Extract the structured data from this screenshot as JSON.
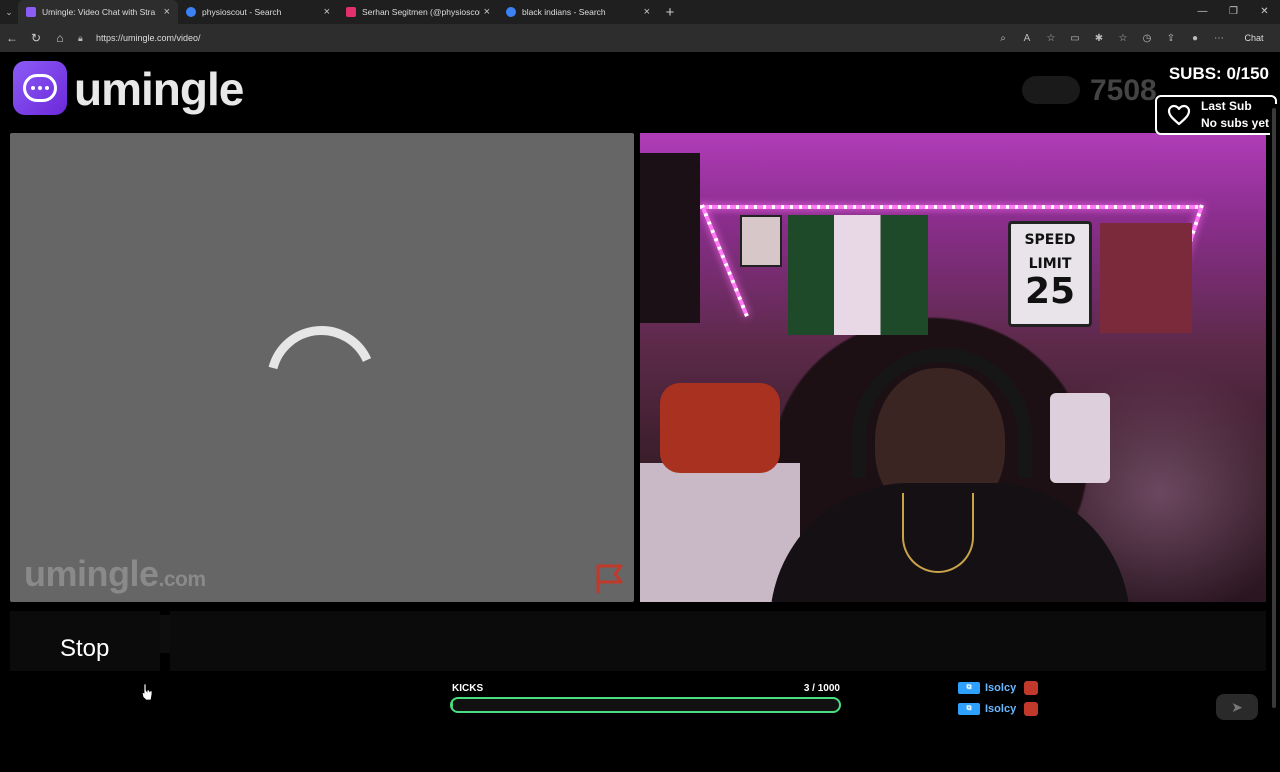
{
  "browser": {
    "tabs": [
      {
        "title": "Umingle: Video Chat with Stra",
        "favicon_color": "#8b5cf6",
        "active": true
      },
      {
        "title": "physioscout - Search",
        "favicon_color": "#3b82f6",
        "active": false
      },
      {
        "title": "Serhan Segitmen (@physioscout)",
        "favicon_color": "#e1306c",
        "active": false
      },
      {
        "title": "black indians - Search",
        "favicon_color": "#3b82f6",
        "active": false
      }
    ],
    "url": "https://umingle.com/video/",
    "chat_button_label": "Chat"
  },
  "site": {
    "logo_text": "umingle",
    "online_count": "7508 ",
    "accent_color": "#8b5cf6"
  },
  "overlay": {
    "subs_label": "SUBS: 0/150",
    "last_sub_title": "Last Sub",
    "last_sub_value": "No subs yet"
  },
  "video_left": {
    "watermark_main": "umingle",
    "watermark_suffix": ".com"
  },
  "video_right": {
    "sign_line1": "SPEED",
    "sign_line2": "LIMIT",
    "sign_number": "25"
  },
  "controls": {
    "stop_label": "Stop"
  },
  "kicks": {
    "label": "KICKS",
    "count_text": "3 / 1000",
    "current": 3,
    "goal": 1000,
    "bar_color": "#4ade80"
  },
  "feed": [
    {
      "name": "Isolcy"
    },
    {
      "name": "Isolcy"
    }
  ]
}
